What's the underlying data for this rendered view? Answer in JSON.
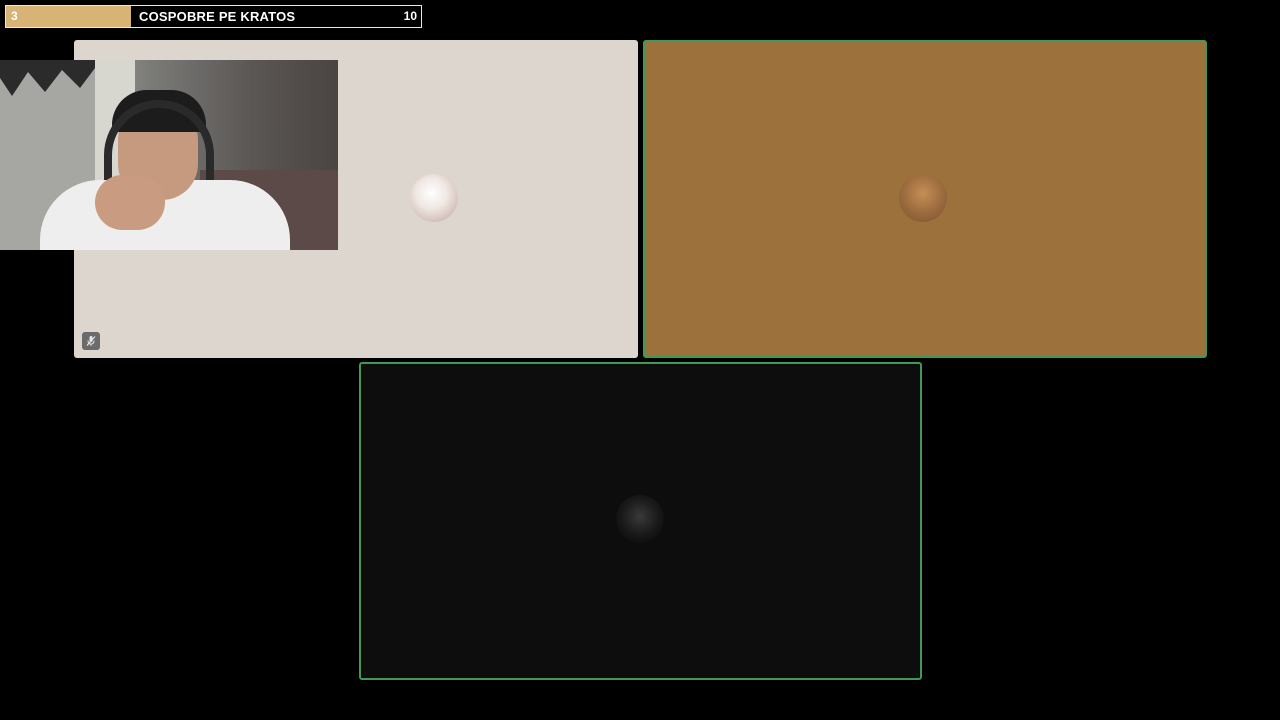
{
  "goal": {
    "current": "3",
    "title": "COSPOBRE PE KRATOS",
    "target": "10",
    "progress_fraction": 0.3,
    "fill_color": "#d7b475"
  },
  "tiles": [
    {
      "bg_color": "#dcd6cf",
      "muted": true,
      "speaking": false,
      "avatar_icon": "avatar-icon"
    },
    {
      "bg_color": "#9c713c",
      "muted": false,
      "speaking": true,
      "avatar_icon": "avatar-icon"
    },
    {
      "bg_color": "#0d0d0d",
      "muted": false,
      "speaking": true,
      "avatar_icon": "avatar-icon"
    }
  ],
  "colors": {
    "background": "#000000",
    "speaking_border": "#3f9a55",
    "mute_badge": "#6b6b6b"
  },
  "icons": {
    "mute": "muted-microphone-icon"
  }
}
